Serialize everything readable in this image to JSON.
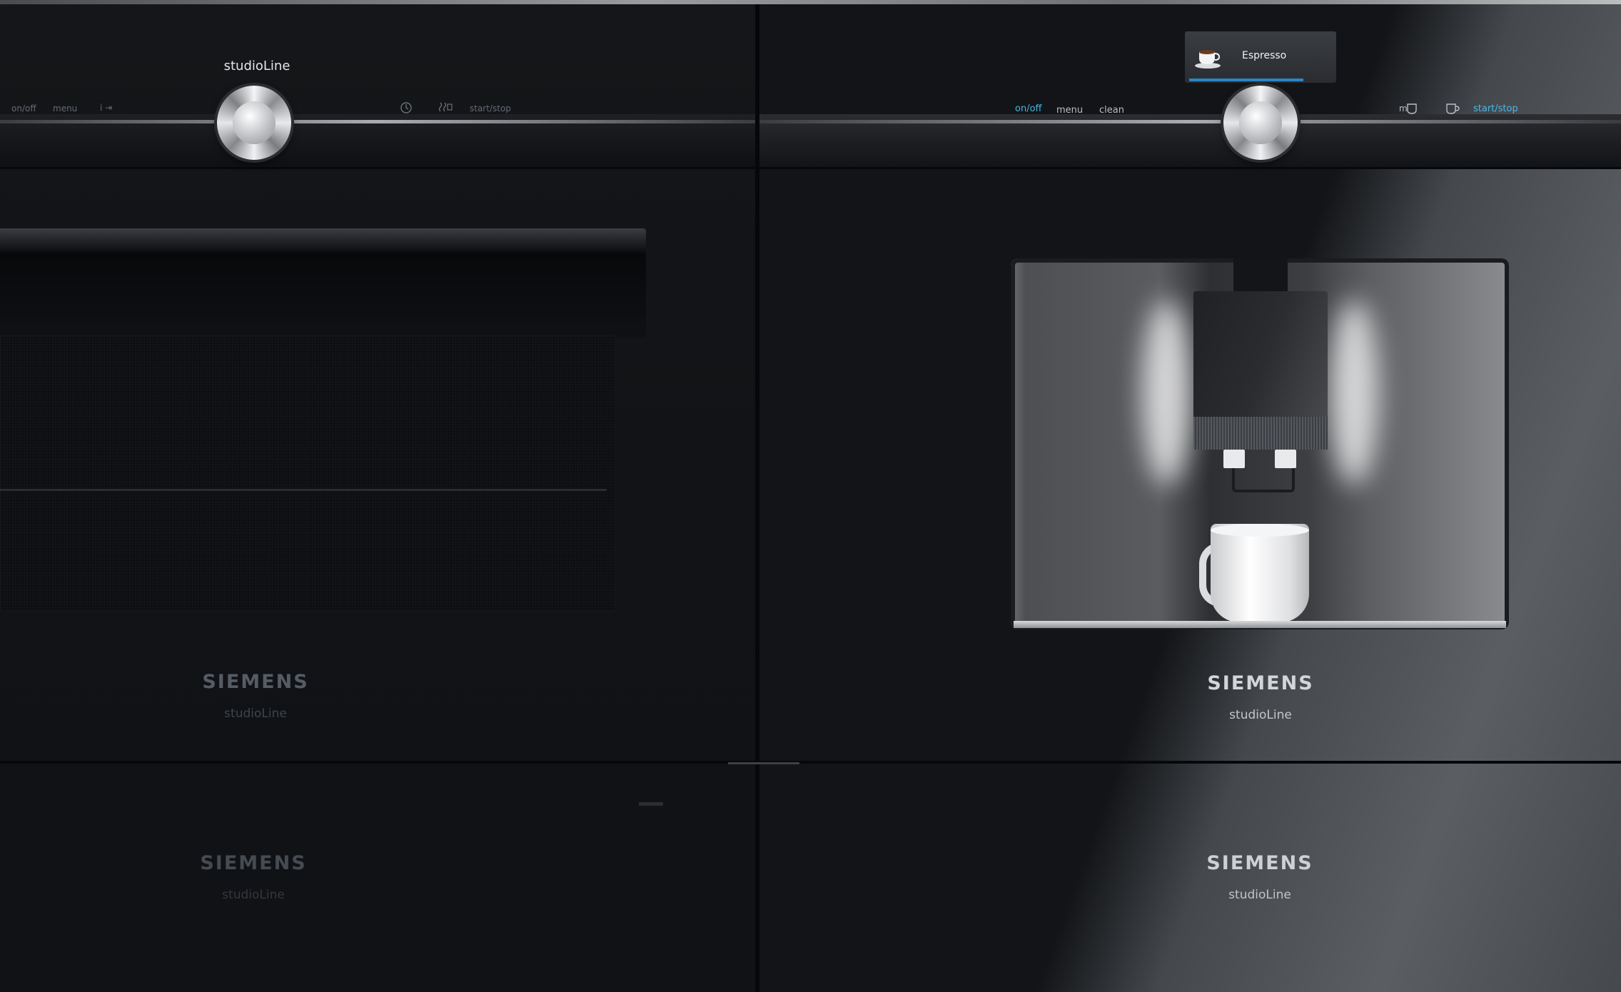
{
  "oven": {
    "header_brand": "studioLine",
    "controls": {
      "onoff": "on/off",
      "menu": "menu",
      "info": "i ⇥",
      "timer_icon": "clock-icon",
      "heat_icon": "hot-air-icon",
      "startstop": "start/stop"
    },
    "brand": "SIEMENS",
    "subbrand": "studioLine"
  },
  "coffee": {
    "display": {
      "icon": "coffee-cup-icon",
      "label": "Espresso"
    },
    "controls": {
      "onoff": "on/off",
      "menu": "menu",
      "clean": "clean",
      "mycoffee_icon": "my-coffee-icon",
      "cup_icon": "cup-icon",
      "startstop": "start/stop"
    },
    "brand": "SIEMENS",
    "subbrand": "studioLine"
  },
  "drawer_left": {
    "brand": "SIEMENS",
    "subbrand": "studioLine"
  },
  "drawer_right": {
    "brand": "SIEMENS",
    "subbrand": "studioLine"
  },
  "colors": {
    "accent": "#4ab7e6",
    "display_bar": "#2b86c6"
  }
}
